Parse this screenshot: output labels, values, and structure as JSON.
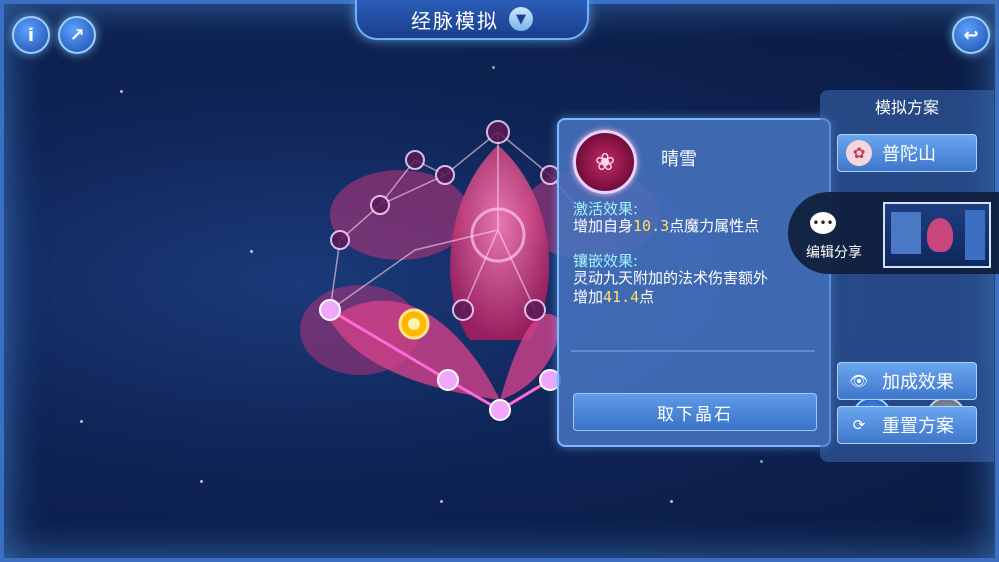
{
  "header": {
    "title": "经脉模拟",
    "dropdown_icon": "chevron-down-icon"
  },
  "top_left_buttons": [
    {
      "name": "info",
      "glyph": "i"
    },
    {
      "name": "share-export",
      "glyph": "↗"
    }
  ],
  "back_button": {
    "glyph": "↩"
  },
  "stone_info": {
    "name": "晴雪",
    "activate_title": "激活效果:",
    "activate_prefix": "增加自身",
    "activate_value": "10.3",
    "activate_suffix": "点魔力属性点",
    "inlay_title": "镶嵌效果:",
    "inlay_line1": "灵动九天附加的法术伤害额外",
    "inlay_prefix": "增加",
    "inlay_value": "41.4",
    "inlay_suffix": "点",
    "remove_button": "取下晶石"
  },
  "scheme_panel": {
    "title": "模拟方案",
    "sect_button": "普陀山",
    "bonus_button": "加成效果",
    "reset_button": "重置方案"
  },
  "share_popup": {
    "label": "编辑分享"
  },
  "colors": {
    "accent_blue": "#3a72c8",
    "highlight_yellow": "#ffe066",
    "section_title": "#9ff5ff",
    "lotus_pink": "#e0408a"
  }
}
